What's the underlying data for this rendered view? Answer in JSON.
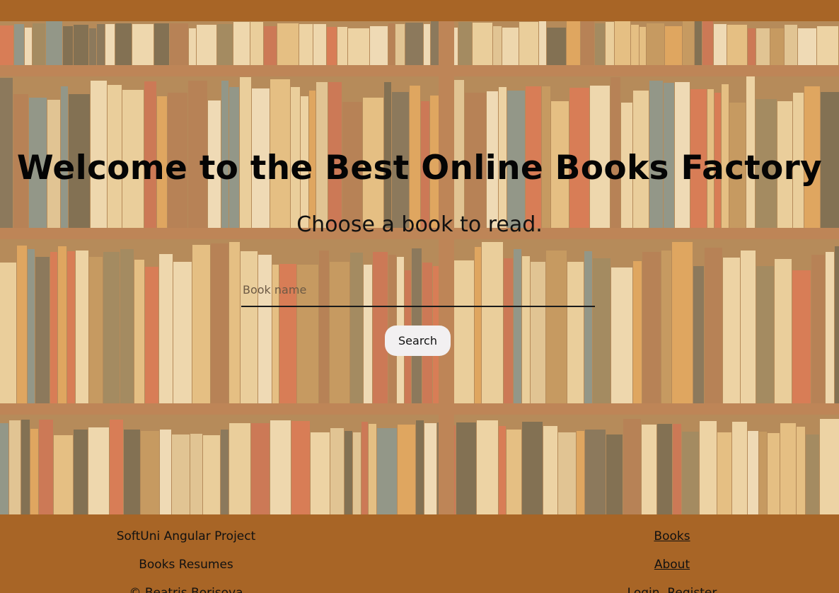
{
  "hero": {
    "title": "Welcome to the Best Online Books Factory",
    "subtitle": "Choose a book to read."
  },
  "search": {
    "placeholder": "Book name",
    "value": "",
    "button_label": "Search"
  },
  "footer": {
    "left": {
      "project": "SoftUni Angular Project",
      "resumes": "Books Resumes",
      "copyright": "© Beatris Borisova"
    },
    "nav": {
      "books": "Books",
      "about": "About",
      "login": "Login",
      "register": "Register"
    }
  },
  "colors": {
    "bar": "#a86526",
    "overlay": "#ecc88c"
  }
}
